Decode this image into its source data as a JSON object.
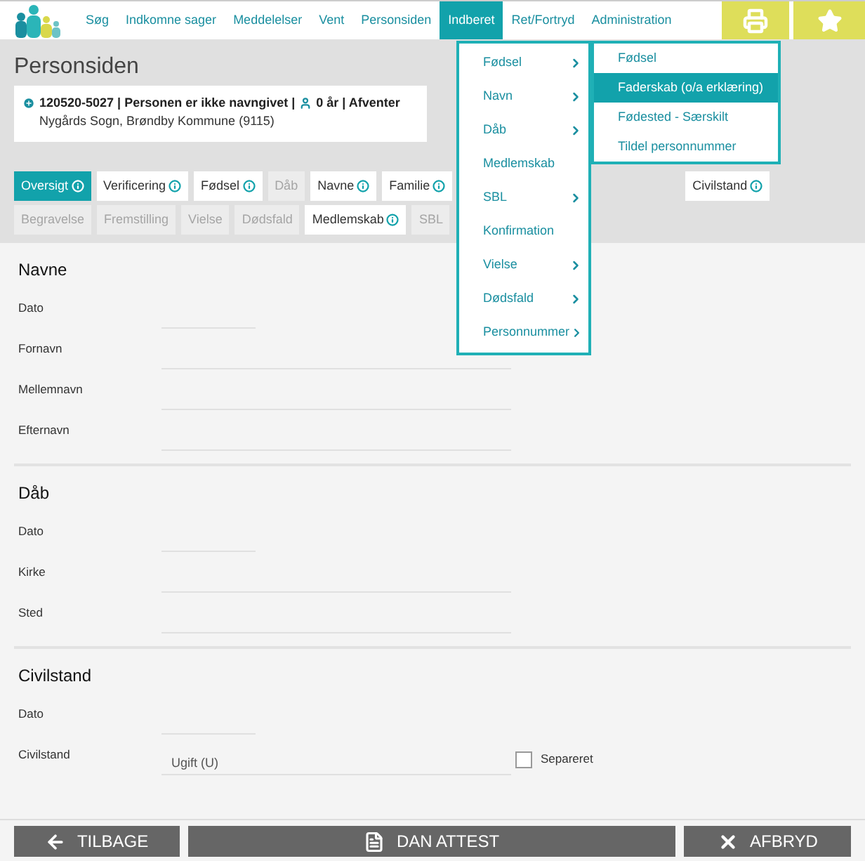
{
  "nav": {
    "items": [
      {
        "label": "Søg",
        "selected": false
      },
      {
        "label": "Indkomne sager",
        "selected": false
      },
      {
        "label": "Meddelelser",
        "selected": false
      },
      {
        "label": "Vent",
        "selected": false
      },
      {
        "label": "Personsiden",
        "selected": false
      },
      {
        "label": "Indberet",
        "selected": true
      },
      {
        "label": "Ret/Fortryd",
        "selected": false
      },
      {
        "label": "Administration",
        "selected": false
      }
    ]
  },
  "page_title": "Personsiden",
  "person": {
    "lead": "120520-5027 | Personen er ikke navngivet |",
    "tail": "0 år | Afventer",
    "parish": "Nygårds Sogn, Brøndby Kommune (9115)"
  },
  "tab_rows": [
    [
      {
        "label": "Oversigt",
        "info": true,
        "disabled": false,
        "selected": true
      },
      {
        "label": "Verificering",
        "info": true,
        "disabled": false,
        "selected": false
      },
      {
        "label": "Fødsel",
        "info": true,
        "disabled": false,
        "selected": false
      },
      {
        "label": "Dåb",
        "info": false,
        "disabled": true,
        "selected": false
      },
      {
        "label": "Navne",
        "info": true,
        "disabled": false,
        "selected": false
      },
      {
        "label": "Familie",
        "info": true,
        "disabled": false,
        "selected": false
      },
      {
        "label": "Civilstand",
        "info": true,
        "disabled": false,
        "selected": false
      }
    ],
    [
      {
        "label": "Begravelse",
        "info": false,
        "disabled": true,
        "selected": false
      },
      {
        "label": "Fremstilling",
        "info": false,
        "disabled": true,
        "selected": false
      },
      {
        "label": "Vielse",
        "info": false,
        "disabled": true,
        "selected": false
      },
      {
        "label": "Dødsfald",
        "info": false,
        "disabled": true,
        "selected": false
      },
      {
        "label": "Medlemskab",
        "info": true,
        "disabled": false,
        "selected": false
      },
      {
        "label": "SBL",
        "info": false,
        "disabled": true,
        "selected": false
      }
    ]
  ],
  "menu": {
    "items": [
      {
        "label": "Fødsel",
        "submenu": true
      },
      {
        "label": "Navn",
        "submenu": true
      },
      {
        "label": "Dåb",
        "submenu": true
      },
      {
        "label": "Medlemskab",
        "submenu": false
      },
      {
        "label": "SBL",
        "submenu": true
      },
      {
        "label": "Konfirmation",
        "submenu": false
      },
      {
        "label": "Vielse",
        "submenu": true
      },
      {
        "label": "Dødsfald",
        "submenu": true
      },
      {
        "label": "Personnummer",
        "submenu": true
      }
    ],
    "submenu": [
      {
        "label": "Fødsel",
        "selected": false
      },
      {
        "label": "Faderskab (o/a erklæring)",
        "selected": true
      },
      {
        "label": "Fødested - Særskilt",
        "selected": false
      },
      {
        "label": "Tildel personnummer",
        "selected": false
      }
    ]
  },
  "sections": [
    {
      "title": "Navne",
      "fields": [
        {
          "label": "Dato",
          "kind": "date"
        },
        {
          "label": "Fornavn",
          "kind": "text"
        },
        {
          "label": "Mellemnavn",
          "kind": "text"
        },
        {
          "label": "Efternavn",
          "kind": "text"
        }
      ]
    },
    {
      "title": "Dåb",
      "fields": [
        {
          "label": "Dato",
          "kind": "date"
        },
        {
          "label": "Kirke",
          "kind": "text"
        },
        {
          "label": "Sted",
          "kind": "text"
        }
      ]
    },
    {
      "title": "Civilstand",
      "fields": [
        {
          "label": "Dato",
          "kind": "date"
        },
        {
          "label": "Civilstand",
          "kind": "text",
          "value": "Ugift (U)",
          "checkbox": {
            "label": "Separeret",
            "checked": false
          }
        }
      ]
    }
  ],
  "footer_buttons": [
    {
      "label": "TILBAGE",
      "kind": "back"
    },
    {
      "label": "DAN ATTEST",
      "kind": "document"
    },
    {
      "label": "AFBRYD",
      "kind": "cancel"
    }
  ]
}
